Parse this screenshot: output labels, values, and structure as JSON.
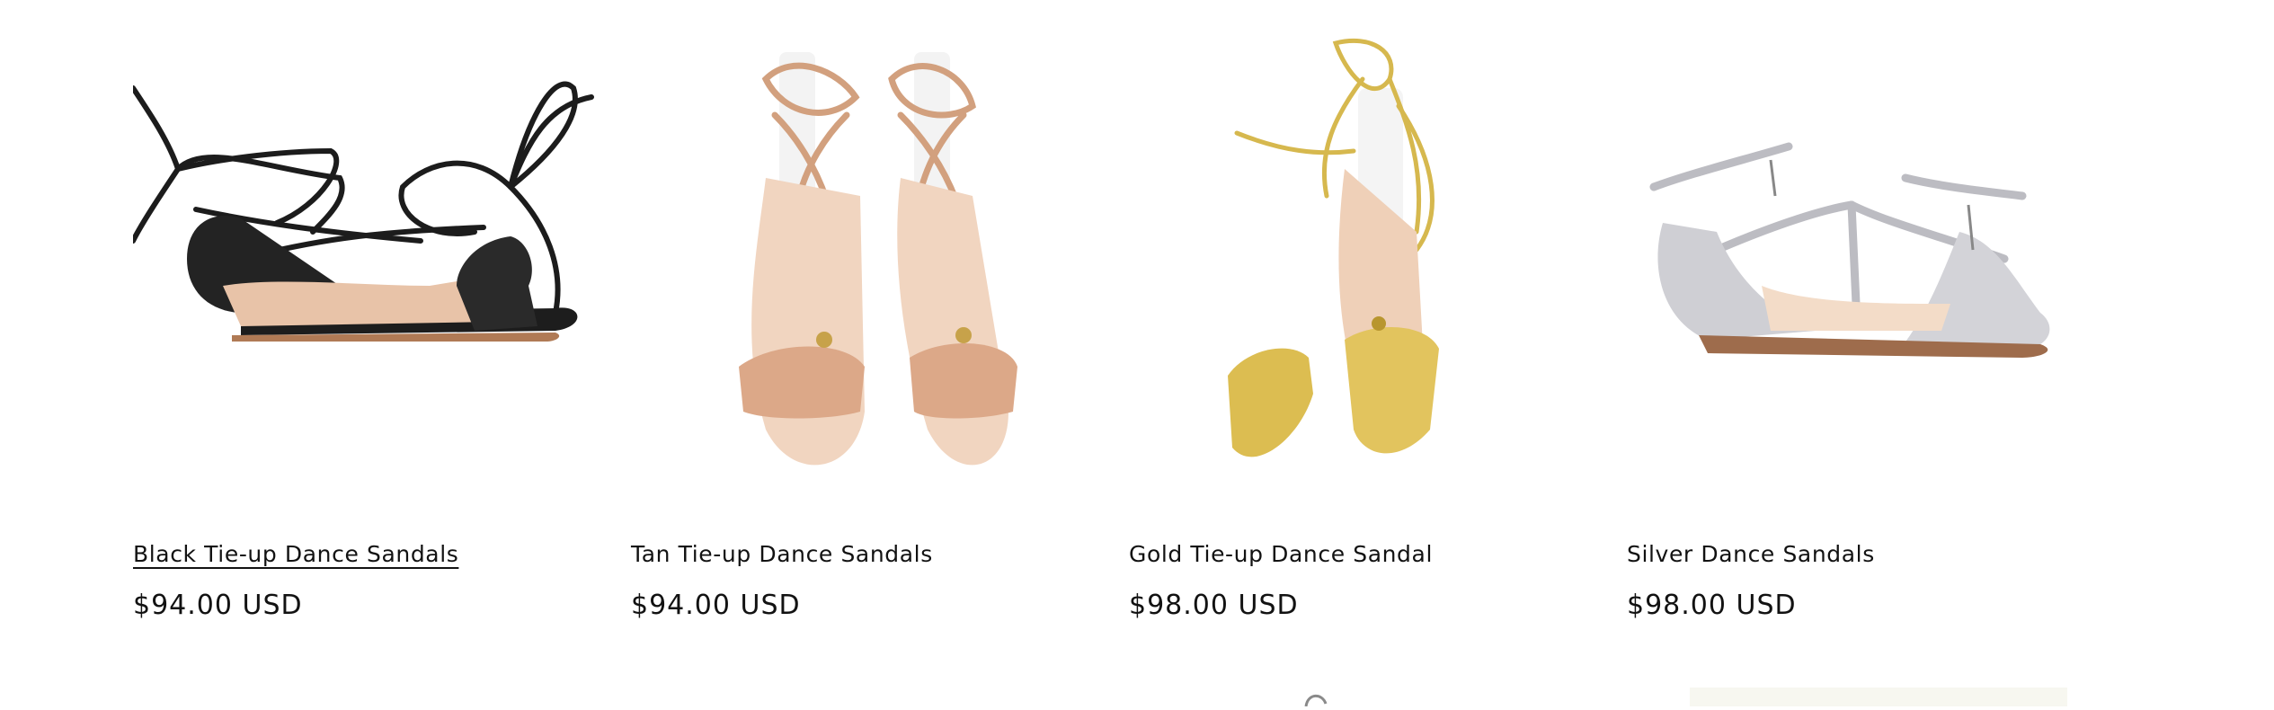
{
  "products": [
    {
      "title": "Black Tie-up Dance Sandals",
      "price": "$94.00 USD",
      "image": "black-tie-up-sandals-image",
      "color": "#1c1c1c"
    },
    {
      "title": "Tan Tie-up Dance Sandals",
      "price": "$94.00 USD",
      "image": "tan-tie-up-sandals-image",
      "color": "#d9a98a"
    },
    {
      "title": "Gold Tie-up Dance Sandal",
      "price": "$98.00 USD",
      "image": "gold-tie-up-sandal-image",
      "color": "#d8bc55"
    },
    {
      "title": "Silver Dance Sandals",
      "price": "$98.00 USD",
      "image": "silver-dance-sandals-image",
      "color": "#c8c8cc"
    }
  ],
  "hovered_product": "Black Tie-up Dance Sandals"
}
